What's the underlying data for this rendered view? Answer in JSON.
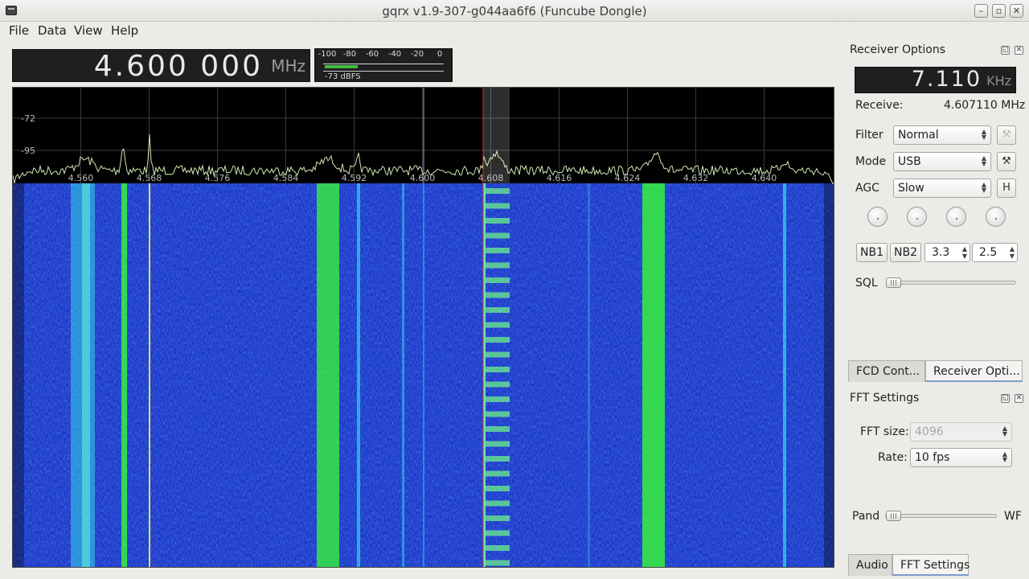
{
  "window": {
    "title": "gqrx v1.9-307-g044aa6f6 (Funcube Dongle)"
  },
  "menu": {
    "items": [
      "File",
      "Data",
      "View",
      "Help"
    ]
  },
  "frequency": {
    "digits": "4.600 000",
    "unit": "MHz"
  },
  "smeter": {
    "scale": [
      "-100",
      "-80",
      "-60",
      "-40",
      "-20",
      "0"
    ],
    "level_text": "-73 dBFS",
    "level_fraction": 0.27
  },
  "plot": {
    "y_ticks": [
      "-72",
      "-95"
    ],
    "x_ticks": [
      "4.560",
      "4.568",
      "4.576",
      "4.584",
      "4.592",
      "4.600",
      "4.608",
      "4.616",
      "4.624",
      "4.632",
      "4.640"
    ],
    "colors": {
      "background": "#000000",
      "spectrum": "#cfe8b4",
      "waterfall_base": "#1b35c8",
      "signal": "#36f23a",
      "cyan": "#35d6e6",
      "marker": "#e03030"
    }
  },
  "receiver": {
    "title": "Receiver Options",
    "freq_digits": "7.110",
    "freq_unit": "KHz",
    "receive_label": "Receive:",
    "receive_value": "4.607110 MHz",
    "filter_label": "Filter",
    "filter_value": "Normal",
    "mode_label": "Mode",
    "mode_value": "USB",
    "agc_label": "AGC",
    "agc_value": "Slow",
    "agc_button": "H",
    "nb1": "NB1",
    "nb2": "NB2",
    "nb1_value": "3.3",
    "nb2_value": "2.5",
    "sql_label": "SQL",
    "sql_level": 0.0
  },
  "tabs_top": [
    "FCD Cont...",
    "Receiver Opti..."
  ],
  "fft": {
    "title": "FFT Settings",
    "size_label": "FFT size:",
    "size_value": "4096",
    "rate_label": "Rate:",
    "rate_value": "10 fps",
    "pand_label": "Pand",
    "wf_label": "WF"
  },
  "tabs_bottom": [
    "Audio",
    "FFT Settings"
  ]
}
